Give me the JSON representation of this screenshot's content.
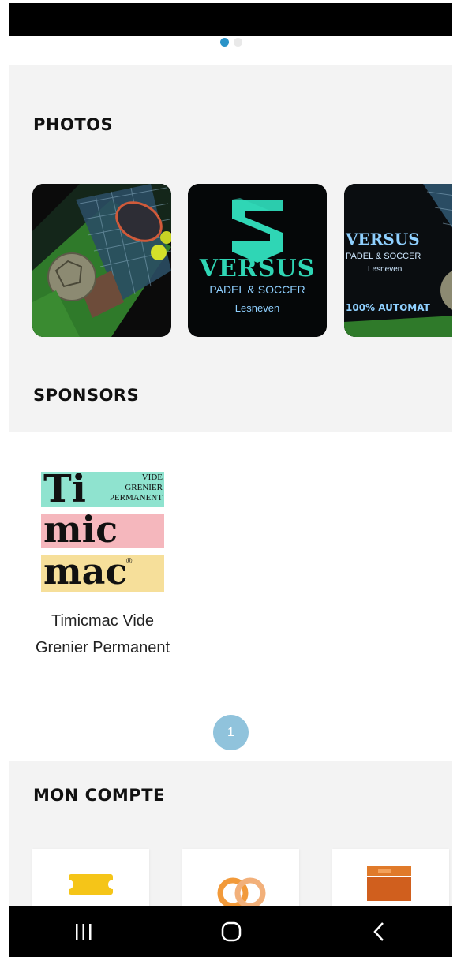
{
  "carousel": {
    "dot_count": 2,
    "active_index": 0
  },
  "photos": {
    "title": "PHOTOS",
    "items": [
      {
        "name": "padel-soccer-balls-photo"
      },
      {
        "brand": "VERSUS",
        "subtitle": "PADEL & SOCCER",
        "city": "Lesneven"
      },
      {
        "brand": "VERSUS",
        "subtitle": "PADEL & SOCCER",
        "city": "Lesneven",
        "banner": "100% AUTOMAT"
      }
    ]
  },
  "sponsors": {
    "title": "SPONSORS",
    "items": [
      {
        "name": "Timicmac Vide Grenier Permanent",
        "logo": {
          "ti": "Ti",
          "vide": "VIDE",
          "grenier": "GRENIER",
          "permanent": "PERMANENT",
          "mic": "mic",
          "mac": "mac",
          "reg": "®"
        }
      }
    ],
    "pagination": {
      "current": "1"
    }
  },
  "account": {
    "title": "MON COMPTE",
    "cards": [
      {
        "icon": "ticket-icon"
      },
      {
        "icon": "rings-icon"
      },
      {
        "icon": "wallet-icon"
      }
    ]
  },
  "nav": {
    "icons": [
      "recent-apps-icon",
      "home-icon",
      "back-icon"
    ]
  },
  "colors": {
    "accent": "#2a93c8",
    "badge": "#90c3dc",
    "versus_teal": "#2fd6b5",
    "versus_blue": "#8fd0ff"
  }
}
